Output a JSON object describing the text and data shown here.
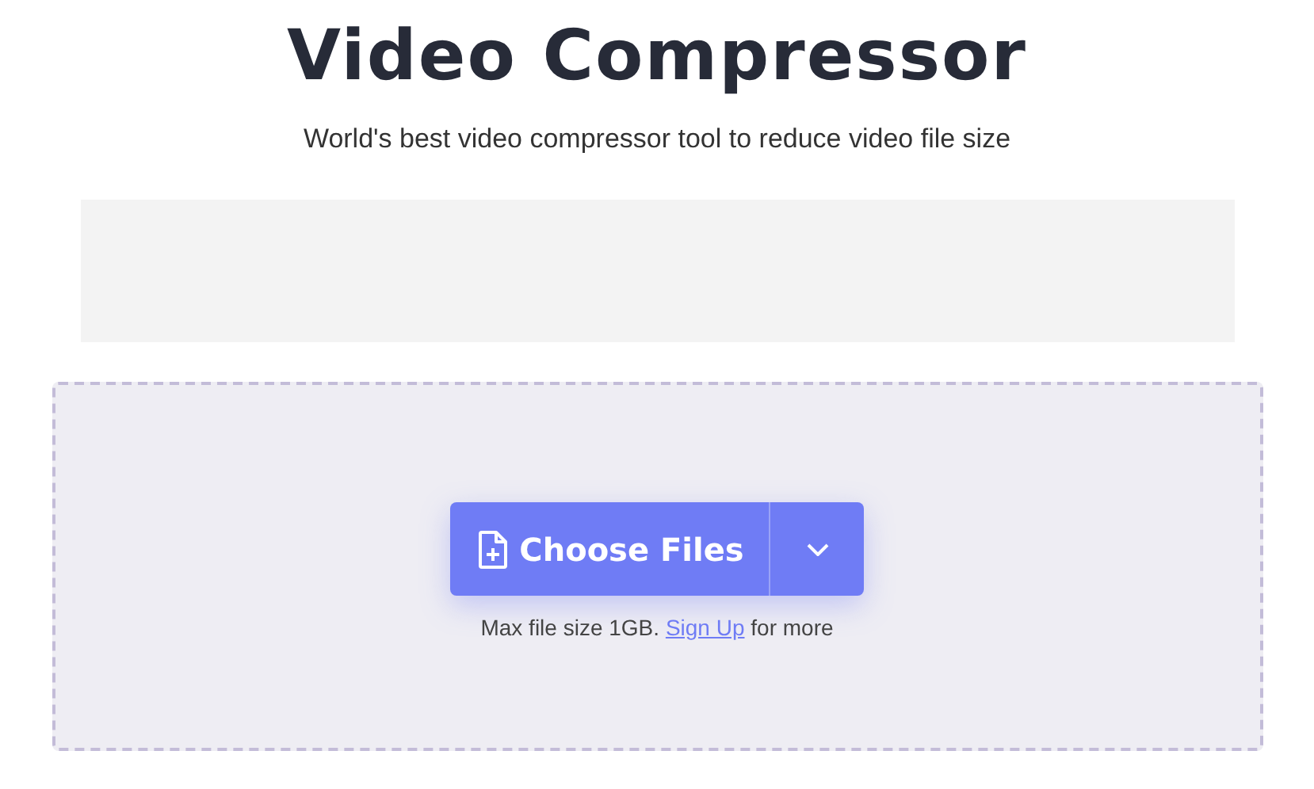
{
  "title": "Video Compressor",
  "subtitle": "World's best video compressor tool to reduce video file size",
  "dropzone": {
    "button": "Choose Files",
    "note_before": "Max file size 1GB.",
    "link": "Sign Up",
    "note_after": "for more"
  }
}
